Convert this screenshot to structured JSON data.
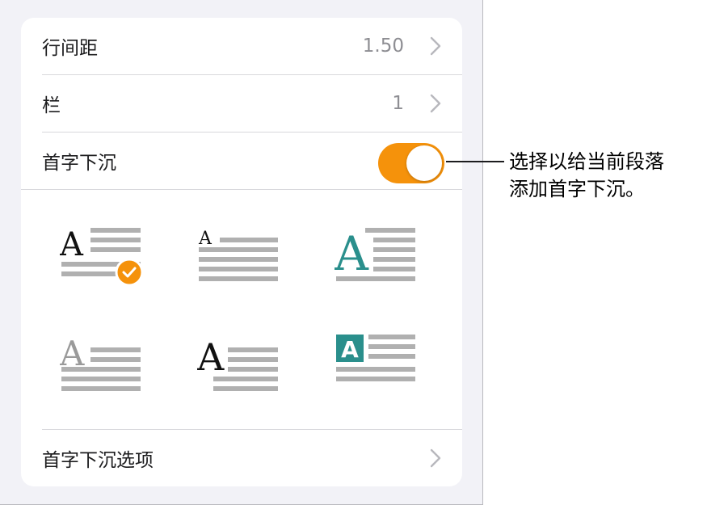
{
  "settings": {
    "line_spacing": {
      "label": "行间距",
      "value": "1.50"
    },
    "columns": {
      "label": "栏",
      "value": "1"
    },
    "drop_cap": {
      "label": "首字下沉",
      "enabled": true
    },
    "drop_cap_options": {
      "label": "首字下沉选项"
    }
  },
  "drop_cap_styles": {
    "selected_index": 0,
    "letter": "A",
    "accent_color": "#2a8f8c",
    "check_color": "#f5920b"
  },
  "callout": {
    "line1": "选择以给当前段落",
    "line2": "添加首字下沉。"
  },
  "colors": {
    "toggle_on": "#f5920b",
    "secondary_text": "#8e8e93",
    "lines": "#b0b0b0"
  }
}
